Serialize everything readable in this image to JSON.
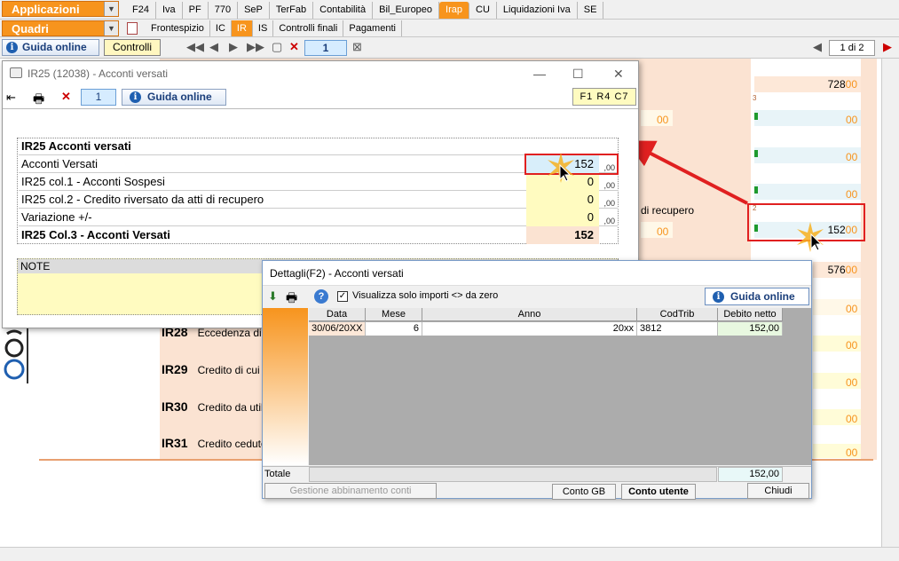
{
  "menubar": {
    "applicazioni": "Applicazioni",
    "quadri": "Quadri",
    "tabs": [
      "F24",
      "Iva",
      "PF",
      "770",
      "SeP",
      "TerFab",
      "Contabilità",
      "Bil_Europeo",
      "Irap",
      "CU",
      "Liquidazioni Iva",
      "SE"
    ],
    "active_tab": "Irap",
    "subtabs": [
      "Frontespizio",
      "IC",
      "IR",
      "IS",
      "Controlli finali",
      "Pagamenti"
    ],
    "active_subtab": "IR"
  },
  "toolbar": {
    "guida_label": "Guida online",
    "controlli_label": "Controlli",
    "page_number": "1",
    "page_of": "1 di 2"
  },
  "background_form": {
    "val_top": "728",
    "val_cents": "00",
    "small_num_3": "3",
    "small_num_2": "2",
    "di_recupero": "di recupero",
    "val_152": "152",
    "val_576": "576",
    "rows": [
      {
        "code": "IR28",
        "text": "Eccedenza di v"
      },
      {
        "code": "IR29",
        "text": "Credito di cui s"
      },
      {
        "code": "IR30",
        "text": "Credito da utili"
      },
      {
        "code": "IR31",
        "text": "Credito ceduto"
      }
    ]
  },
  "win1": {
    "title": "IR25 (12038) - Acconti versati",
    "page_number": "1",
    "guida_label": "Guida online",
    "code_label": "F1 R4 C7",
    "table_title": "IR25 Acconti versati",
    "rows": [
      {
        "label": "Acconti Versati",
        "value": "152",
        "cents": ",00"
      },
      {
        "label": "IR25 col.1  - Acconti Sospesi",
        "value": "0",
        "cents": ",00"
      },
      {
        "label": "IR25 col.2  - Credito riversato da atti di recupero",
        "value": "0",
        "cents": ",00"
      },
      {
        "label": "Variazione +/-",
        "value": "0",
        "cents": ",00"
      }
    ],
    "total_label": "IR25 Col.3 - Acconti Versati",
    "total_value": "152",
    "note_label": "NOTE"
  },
  "win2": {
    "title": "Dettagli(F2) - Acconti versati",
    "checkbox_label": "Visualizza solo importi <> da zero",
    "checkbox_checked": true,
    "guida_label": "Guida online",
    "columns": [
      "Data",
      "Mese",
      "Anno",
      "CodTrib",
      "Debito netto"
    ],
    "rows": [
      {
        "data": "30/06/20XX",
        "mese": "6",
        "anno": "20xx",
        "codtrib": "3812",
        "debito": "152,00"
      }
    ],
    "totale_label": "Totale",
    "totale_value": "152,00",
    "btn_gestione": "Gestione abbinamento conti",
    "btn_conto_gb": "Conto GB",
    "btn_conto_utente": "Conto utente",
    "btn_chiudi": "Chiudi"
  }
}
